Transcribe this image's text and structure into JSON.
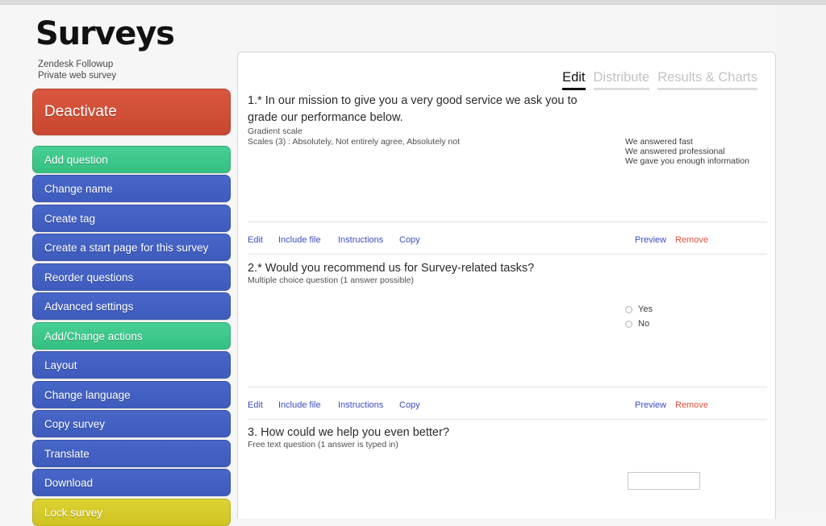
{
  "app": {
    "brand_title": "Surveys",
    "survey_name": "Zendesk Followup",
    "survey_type": "Private web survey"
  },
  "sidebar": {
    "primary_action": {
      "label": "Deactivate",
      "color": "#cf4e35"
    },
    "items": [
      {
        "label": "Add question",
        "color": "#3fc98c",
        "style": "green"
      },
      {
        "label": "Change name",
        "color": "#4363c4",
        "style": "blue"
      },
      {
        "label": "Create tag",
        "color": "#4363c4",
        "style": "blue"
      },
      {
        "label": "Create a start page for this survey",
        "color": "#4363c4",
        "style": "blue"
      },
      {
        "label": "Reorder questions",
        "color": "#4363c4",
        "style": "blue"
      },
      {
        "label": "Advanced settings",
        "color": "#4363c4",
        "style": "blue"
      },
      {
        "label": "Add/Change actions",
        "color": "#3fc98c",
        "style": "green"
      },
      {
        "label": "Layout",
        "color": "#4363c4",
        "style": "blue"
      },
      {
        "label": "Change language",
        "color": "#4363c4",
        "style": "blue"
      },
      {
        "label": "Copy survey",
        "color": "#4363c4",
        "style": "blue"
      },
      {
        "label": "Translate",
        "color": "#4363c4",
        "style": "blue"
      },
      {
        "label": "Download",
        "color": "#4363c4",
        "style": "blue"
      },
      {
        "label": "Lock survey",
        "color": "#d8ce2c",
        "style": "yellow"
      }
    ]
  },
  "main": {
    "tabs": [
      {
        "label": "Edit",
        "active": true
      },
      {
        "label": "Distribute",
        "active": false
      },
      {
        "label": "Results & Charts",
        "active": false
      }
    ],
    "actions": {
      "edit": "Edit",
      "include_file": "Include file",
      "instructions": "Instructions",
      "copy": "Copy",
      "preview": "Preview",
      "remove": "Remove"
    },
    "questions": [
      {
        "title": "1.* In our mission to give you a very good service we ask you to grade our performance below.",
        "type_line": "Gradient scale",
        "scale_line": "Scales (3) : Absolutely, Not entirely agree, Absolutely not",
        "statements": [
          "We answered fast",
          "We answered professional",
          "We gave you enough information"
        ]
      },
      {
        "title": "2.* Would you recommend us for Survey-related tasks?",
        "type_line": "Multiple choice question (1 answer possible)",
        "options": [
          "Yes",
          "No"
        ]
      },
      {
        "title": "3. How could we help you even better?",
        "type_line": "Free text question (1 answer is typed in)",
        "input_value": "",
        "input_placeholder": ""
      }
    ]
  }
}
